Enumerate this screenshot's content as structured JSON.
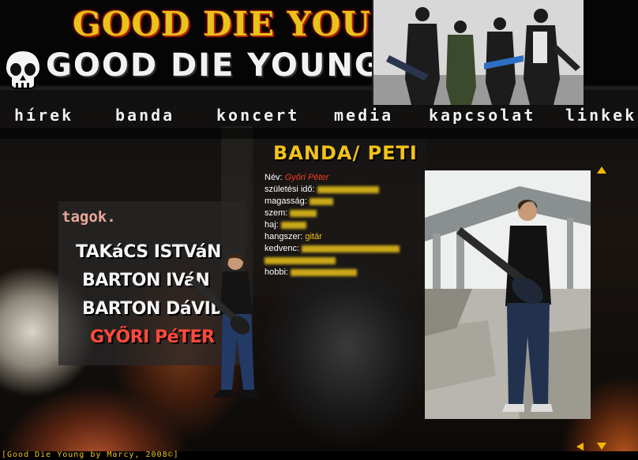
{
  "header": {
    "logo_top": "GOOD DIE YOUNG",
    "logo_main": "GOOD DIE YOUNG"
  },
  "nav": {
    "items": [
      "hírek",
      "banda",
      "koncert",
      "media",
      "kapcsolat",
      "linkek"
    ]
  },
  "members": {
    "title": "tagok.",
    "items": [
      "TAKáCS ISTVáN",
      "BARTON IVáN",
      "BARTON DáVID",
      "GYŐRI PéTER"
    ],
    "active_index": 3
  },
  "profile": {
    "title": "BANDA/ PETI",
    "fields": [
      {
        "label": "Név:",
        "value": "Győri Péter"
      },
      {
        "label": "születési idő:",
        "value": ""
      },
      {
        "label": "magasság:",
        "value": ""
      },
      {
        "label": "szem:",
        "value": ""
      },
      {
        "label": "haj:",
        "value": ""
      },
      {
        "label": "hangszer:",
        "value": "gitár"
      },
      {
        "label": "kedvenc:",
        "value": ""
      },
      {
        "label": "hobbi:",
        "value": ""
      }
    ]
  },
  "footer": {
    "text": "[Good Die Young by Marcy, 2008©]"
  },
  "colors": {
    "accent_yellow": "#f2c21a",
    "accent_red": "#ff3b22",
    "background": "#050505"
  },
  "icons": {
    "skull": "skull-icon",
    "scroll_up": "arrow-up-icon",
    "scroll_down": "arrow-down-icon",
    "scroll_left": "arrow-left-icon"
  }
}
